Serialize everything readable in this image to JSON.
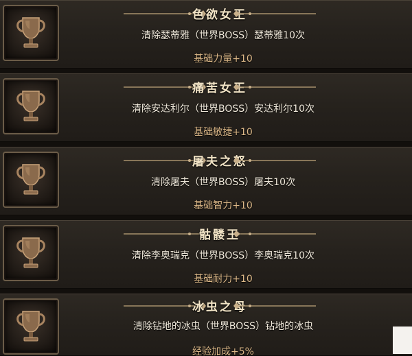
{
  "achievements": [
    {
      "title": "色欲女王",
      "description": "清除瑟蒂雅（世界BOSS）瑟蒂雅10次",
      "reward": "基础力量+10",
      "icon": "trophy-icon"
    },
    {
      "title": "痛苦女王",
      "description": "清除安达利尔（世界BOSS）安达利尔10次",
      "reward": "基础敏捷+10",
      "icon": "trophy-icon"
    },
    {
      "title": "屠夫之怒",
      "description": "清除屠夫（世界BOSS）屠夫10次",
      "reward": "基础智力+10",
      "icon": "trophy-icon"
    },
    {
      "title": "骷髅王",
      "description": "清除李奥瑞克（世界BOSS）李奥瑞克10次",
      "reward": "基础耐力+10",
      "icon": "trophy-icon"
    },
    {
      "title": "冰虫之母",
      "description": "清除钻地的冰虫（世界BOSS）钻地的冰虫",
      "reward": "经验加成+5%",
      "icon": "trophy-icon"
    }
  ],
  "colors": {
    "title": "#f2e4c6",
    "description": "#efe8da",
    "reward": "#dcb888",
    "card_background": "#2e2923",
    "frame": "#6b5c48"
  }
}
